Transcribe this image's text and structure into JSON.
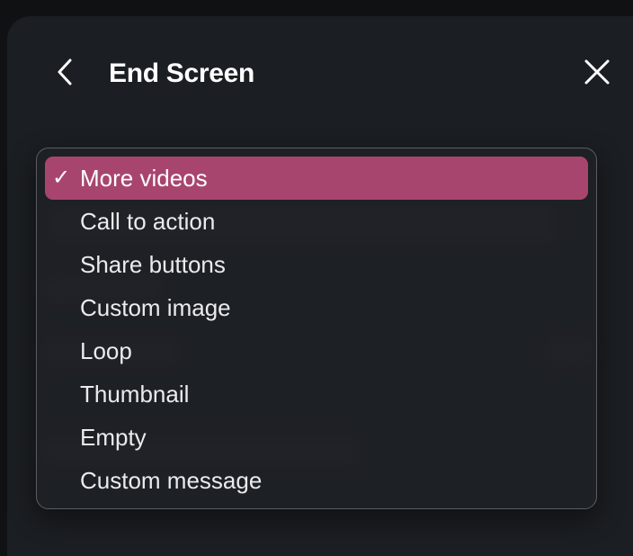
{
  "header": {
    "title": "End Screen",
    "back_icon": "chevron-left-icon",
    "close_icon": "close-icon"
  },
  "dropdown": {
    "selected_index": 0,
    "check_mark": "✓",
    "accent_color": "#a8456f",
    "options": [
      {
        "label": "More videos",
        "selected": true
      },
      {
        "label": "Call to action",
        "selected": false
      },
      {
        "label": "Share buttons",
        "selected": false
      },
      {
        "label": "Custom image",
        "selected": false
      },
      {
        "label": "Loop",
        "selected": false
      },
      {
        "label": "Thumbnail",
        "selected": false
      },
      {
        "label": "Empty",
        "selected": false
      },
      {
        "label": "Custom message",
        "selected": false
      }
    ]
  }
}
